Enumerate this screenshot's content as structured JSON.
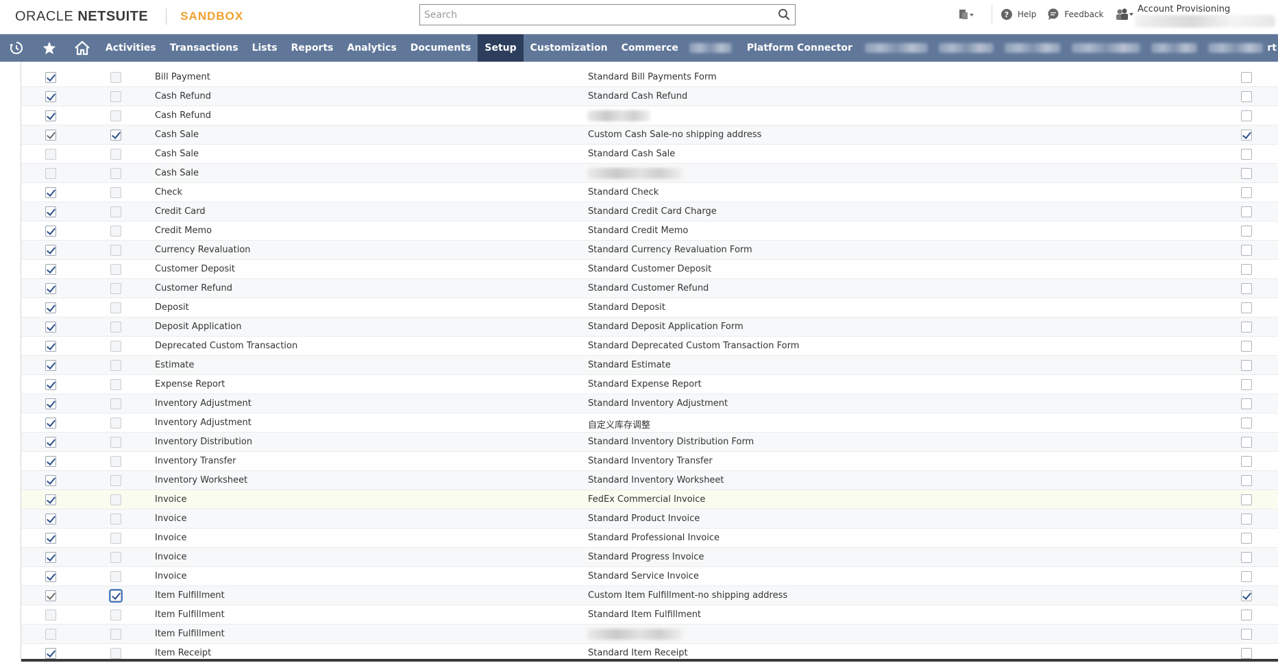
{
  "header": {
    "logo_oracle": "ORACLE",
    "logo_netsuite": "NETSUITE",
    "sandbox_label": "SANDBOX",
    "search_placeholder": "Search",
    "help_label": "Help",
    "feedback_label": "Feedback",
    "account_label": "Account Provisioning"
  },
  "nav": {
    "items": [
      {
        "label": "Activities"
      },
      {
        "label": "Transactions"
      },
      {
        "label": "Lists"
      },
      {
        "label": "Reports"
      },
      {
        "label": "Analytics"
      },
      {
        "label": "Documents"
      },
      {
        "label": "Setup",
        "active": true
      },
      {
        "label": "Customization"
      },
      {
        "label": "Commerce"
      },
      {
        "label": "Platform Connector"
      }
    ],
    "trailing_fragment": "rt"
  },
  "colors": {
    "nav_bg": "#607799",
    "nav_active": "#2c3e5c",
    "sandbox": "#f0a030",
    "check": "#2a4f8a"
  },
  "rows": [
    {
      "type": "Bill Payment",
      "form": "Standard Bill Payments Form",
      "c1": true,
      "c2": false,
      "c5": false
    },
    {
      "type": "Cash Refund",
      "form": "Standard Cash Refund",
      "c1": true,
      "c2": false,
      "c5": false
    },
    {
      "type": "Cash Refund",
      "form": "",
      "c1": true,
      "c2": false,
      "c5": false,
      "blur": true
    },
    {
      "type": "Cash Sale",
      "form": "Custom Cash Sale-no shipping address",
      "c1": true,
      "c2": true,
      "c5": true,
      "grey1": true
    },
    {
      "type": "Cash Sale",
      "form": "Standard Cash Sale",
      "c1": false,
      "c2": false,
      "c5": false
    },
    {
      "type": "Cash Sale",
      "form": "",
      "c1": false,
      "c2": false,
      "c5": false,
      "blur": true
    },
    {
      "type": "Check",
      "form": "Standard Check",
      "c1": true,
      "c2": false,
      "c5": false
    },
    {
      "type": "Credit Card",
      "form": "Standard Credit Card Charge",
      "c1": true,
      "c2": false,
      "c5": false
    },
    {
      "type": "Credit Memo",
      "form": "Standard Credit Memo",
      "c1": true,
      "c2": false,
      "c5": false
    },
    {
      "type": "Currency Revaluation",
      "form": "Standard Currency Revaluation Form",
      "c1": true,
      "c2": false,
      "c5": false
    },
    {
      "type": "Customer Deposit",
      "form": "Standard Customer Deposit",
      "c1": true,
      "c2": false,
      "c5": false
    },
    {
      "type": "Customer Refund",
      "form": "Standard Customer Refund",
      "c1": true,
      "c2": false,
      "c5": false
    },
    {
      "type": "Deposit",
      "form": "Standard Deposit",
      "c1": true,
      "c2": false,
      "c5": false
    },
    {
      "type": "Deposit Application",
      "form": "Standard Deposit Application Form",
      "c1": true,
      "c2": false,
      "c5": false
    },
    {
      "type": "Deprecated Custom Transaction",
      "form": "Standard Deprecated Custom Transaction Form",
      "c1": true,
      "c2": false,
      "c5": false
    },
    {
      "type": "Estimate",
      "form": "Standard Estimate",
      "c1": true,
      "c2": false,
      "c5": false
    },
    {
      "type": "Expense Report",
      "form": "Standard Expense Report",
      "c1": true,
      "c2": false,
      "c5": false
    },
    {
      "type": "Inventory Adjustment",
      "form": "Standard Inventory Adjustment",
      "c1": true,
      "c2": false,
      "c5": false
    },
    {
      "type": "Inventory Adjustment",
      "form": "自定义库存调整",
      "c1": true,
      "c2": false,
      "c5": false
    },
    {
      "type": "Inventory Distribution",
      "form": "Standard Inventory Distribution Form",
      "c1": true,
      "c2": false,
      "c5": false
    },
    {
      "type": "Inventory Transfer",
      "form": "Standard Inventory Transfer",
      "c1": true,
      "c2": false,
      "c5": false
    },
    {
      "type": "Inventory Worksheet",
      "form": "Standard Inventory Worksheet",
      "c1": true,
      "c2": false,
      "c5": false
    },
    {
      "type": "Invoice",
      "form": "FedEx Commercial Invoice",
      "c1": true,
      "c2": false,
      "c5": false,
      "hl": true
    },
    {
      "type": "Invoice",
      "form": "Standard Product Invoice",
      "c1": true,
      "c2": false,
      "c5": false
    },
    {
      "type": "Invoice",
      "form": "Standard Professional Invoice",
      "c1": true,
      "c2": false,
      "c5": false
    },
    {
      "type": "Invoice",
      "form": "Standard Progress Invoice",
      "c1": true,
      "c2": false,
      "c5": false
    },
    {
      "type": "Invoice",
      "form": "Standard Service Invoice",
      "c1": true,
      "c2": false,
      "c5": false
    },
    {
      "type": "Item Fulfillment",
      "form": "Custom Item Fulfillment-no shipping address",
      "c1": true,
      "c2": true,
      "c5": true,
      "grey1": true,
      "focus2": true
    },
    {
      "type": "Item Fulfillment",
      "form": "Standard Item Fulfillment",
      "c1": false,
      "c2": false,
      "c5": false
    },
    {
      "type": "Item Fulfillment",
      "form": "",
      "c1": false,
      "c2": false,
      "c5": false,
      "blur": true
    },
    {
      "type": "Item Receipt",
      "form": "Standard Item Receipt",
      "c1": true,
      "c2": false,
      "c5": false
    }
  ]
}
